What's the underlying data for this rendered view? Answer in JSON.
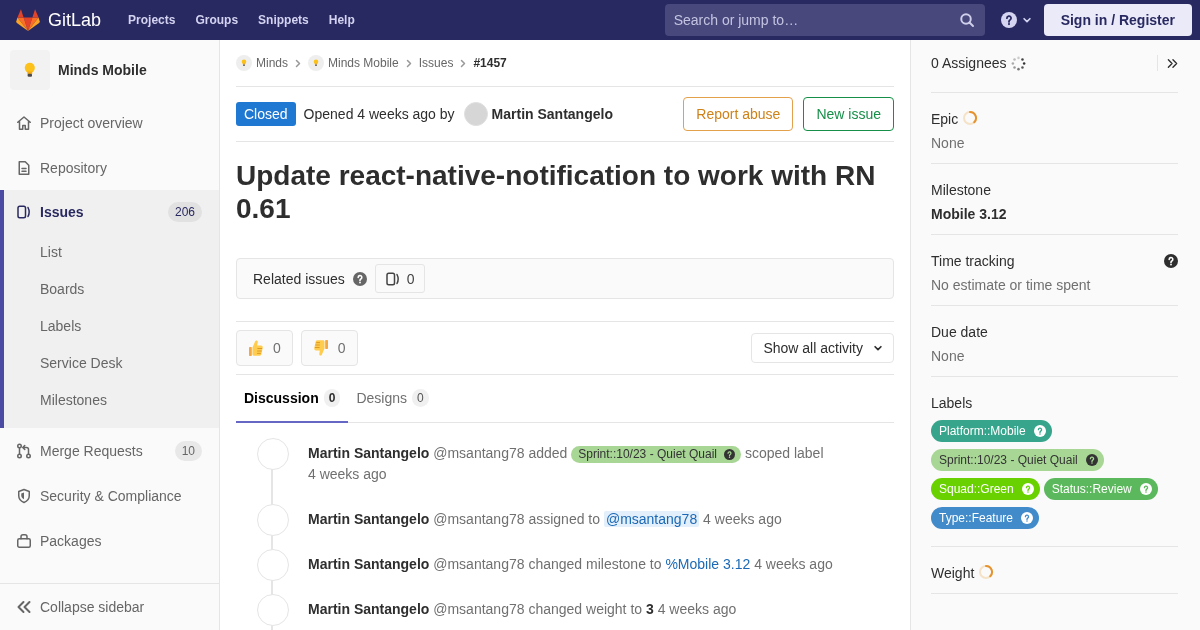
{
  "top_bar": {
    "logo": "GitLab",
    "nav": [
      {
        "label": "Projects"
      },
      {
        "label": "Groups"
      },
      {
        "label": "Snippets"
      },
      {
        "label": "Help"
      }
    ],
    "search": {
      "placeholder": "Search or jump to…"
    },
    "sign_in": "Sign in / Register"
  },
  "sidebar": {
    "project": "Minds Mobile",
    "items": [
      {
        "label": "Project overview",
        "selected": false
      },
      {
        "label": "Repository",
        "selected": false
      },
      {
        "label": "Issues",
        "selected": true,
        "count": "206",
        "children": [
          {
            "label": "List",
            "selected": false
          },
          {
            "label": "Boards",
            "selected": false
          },
          {
            "label": "Labels",
            "selected": false
          },
          {
            "label": "Service Desk",
            "selected": false
          },
          {
            "label": "Milestones",
            "selected": false
          }
        ]
      },
      {
        "label": "Merge Requests",
        "selected": false,
        "count": "10"
      },
      {
        "label": "Security & Compliance",
        "selected": false
      },
      {
        "label": "Packages",
        "selected": false
      }
    ],
    "collapse": "Collapse sidebar"
  },
  "breadcrumbs": [
    {
      "label": "Minds",
      "kind": "group"
    },
    {
      "label": "Minds Mobile",
      "kind": "project"
    },
    {
      "label": "Issues",
      "kind": "link"
    },
    {
      "label": "#1457",
      "kind": "current"
    }
  ],
  "issue": {
    "status": {
      "label": "Closed",
      "kind": "closed"
    },
    "opened": "Opened 4 weeks ago by",
    "author": "Martin Santangelo",
    "actions": [
      {
        "label": "Report abuse",
        "kind": "warning"
      },
      {
        "label": "New issue",
        "kind": "success"
      }
    ],
    "title": "Update react-native-notification to work with RN 0.61",
    "related_issues": {
      "label": "Related issues",
      "count": "0"
    },
    "awards": [
      {
        "kind": "thumbsup",
        "count": "0"
      },
      {
        "kind": "thumbsdown",
        "count": "0"
      }
    ],
    "activity_filter": "Show all activity"
  },
  "tabs": [
    {
      "label": "Discussion",
      "count": "0",
      "selected": true
    },
    {
      "label": "Designs",
      "count": "0",
      "selected": false
    }
  ],
  "notes": [
    {
      "author": "Martin Santangelo",
      "username": "@msantang78",
      "parts": [
        {
          "kind": "text",
          "text": "added"
        },
        {
          "kind": "label",
          "text": "Sprint::10/23 - Quiet Quail",
          "color": "#a8d695"
        },
        {
          "kind": "text",
          "text": "scoped label"
        }
      ],
      "time": "4 weeks ago"
    },
    {
      "author": "Martin Santangelo",
      "username": "@msantang78",
      "parts": [
        {
          "kind": "text",
          "text": "assigned to"
        },
        {
          "kind": "mention",
          "text": "@msantang78"
        }
      ],
      "time": "4 weeks ago"
    },
    {
      "author": "Martin Santangelo",
      "username": "@msantang78",
      "parts": [
        {
          "kind": "text",
          "text": "changed milestone to"
        },
        {
          "kind": "link",
          "text": "%Mobile 3.12"
        }
      ],
      "time": "4 weeks ago"
    },
    {
      "author": "Martin Santangelo",
      "username": "@msantang78",
      "parts": [
        {
          "kind": "text",
          "text": "changed weight to **3**"
        }
      ],
      "time": "4 weeks ago"
    }
  ],
  "right_sidebar": {
    "assignees": {
      "label": "0 Assignees",
      "loading": true
    },
    "sections": [
      {
        "title": "Epic",
        "loading": true,
        "value": "None",
        "muted": true
      },
      {
        "title": "Milestone",
        "value": "Mobile 3.12",
        "muted": false
      },
      {
        "title": "Time tracking",
        "help": true,
        "value": "No estimate or time spent",
        "muted": true
      },
      {
        "title": "Due date",
        "value": "None",
        "muted": true
      },
      {
        "title": "Labels",
        "labels": [
          {
            "text": "Platform::Mobile",
            "color": "#37a58b"
          },
          {
            "text": "Sprint::10/23 - Quiet Quail",
            "color": "#a8d695"
          },
          {
            "text": "Squad::Green",
            "color": "#69d100"
          },
          {
            "text": "Status::Review",
            "color": "#5cb85c"
          },
          {
            "text": "Type::Feature",
            "color": "#428bca"
          }
        ]
      },
      {
        "title": "Weight",
        "loading": true
      }
    ]
  }
}
